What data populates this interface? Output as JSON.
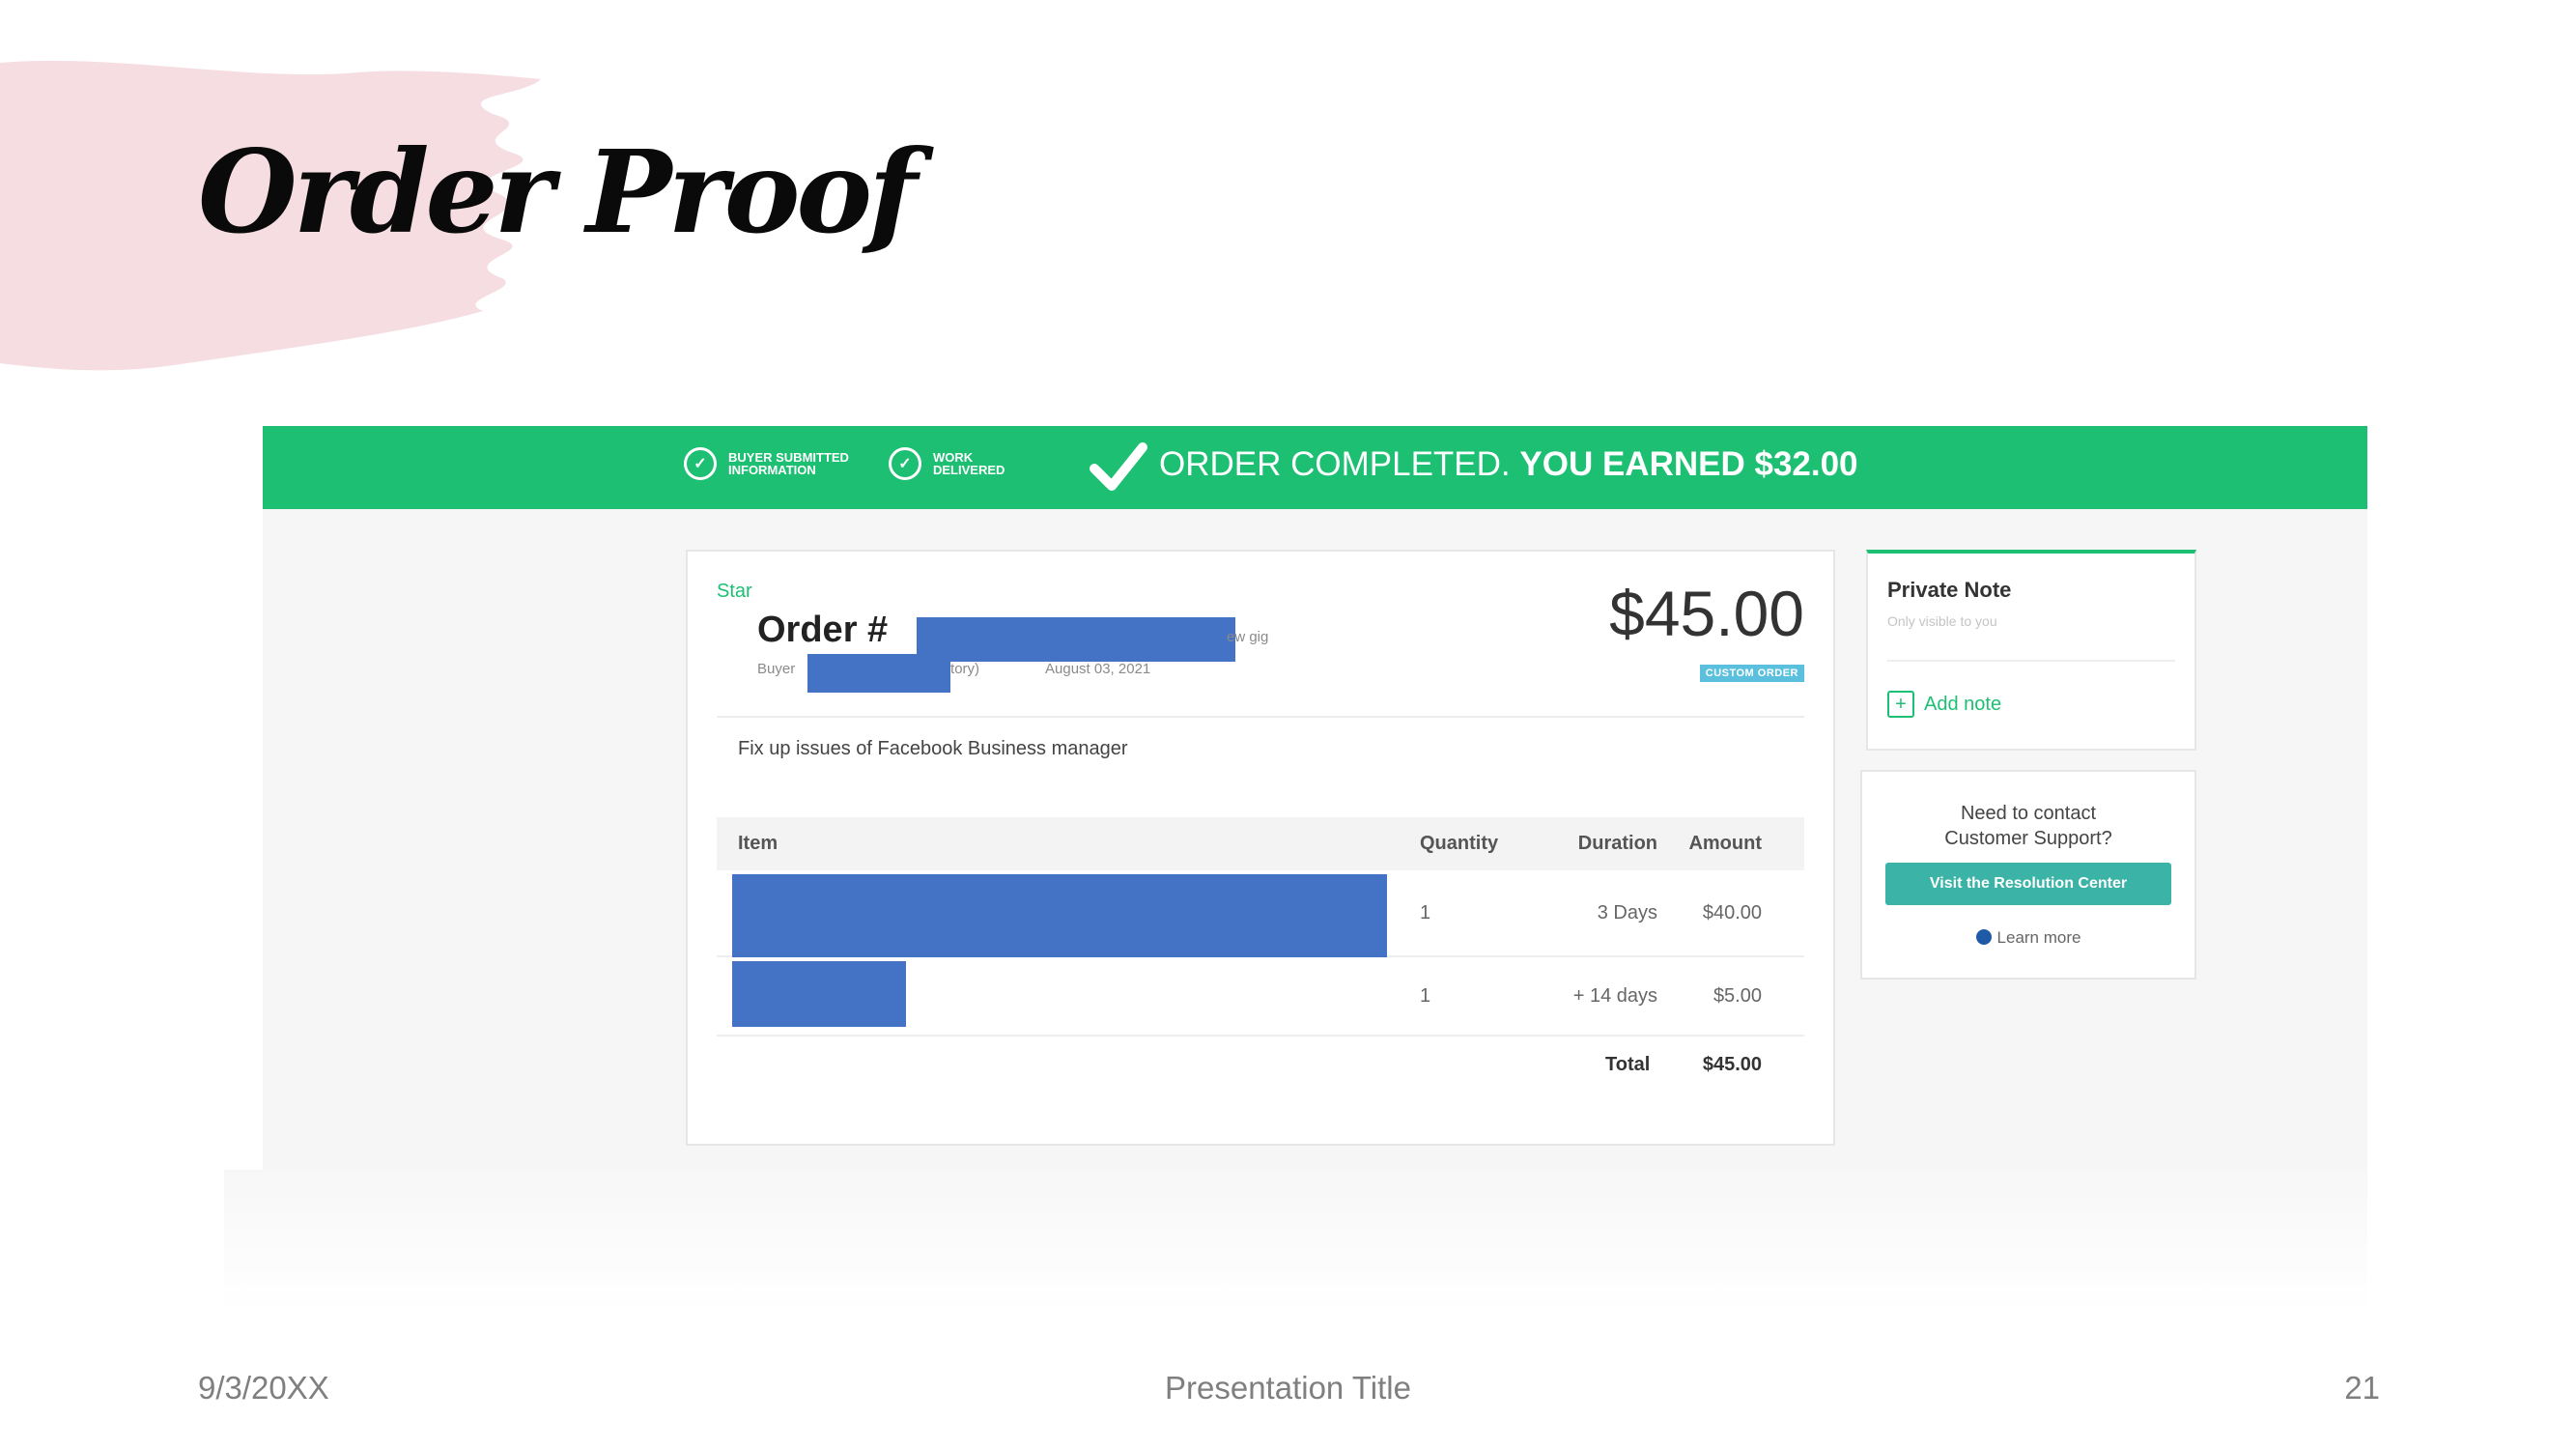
{
  "slide": {
    "title": "Order Proof",
    "footer_date": "9/3/20XX",
    "footer_title": "Presentation Title",
    "page_number": "21"
  },
  "colors": {
    "banner_green": "#1dbf73",
    "redaction_blue": "#4472c4",
    "brush_pink": "#f5dde2",
    "resolution_button": "#3bb3a6"
  },
  "banner": {
    "step1": "BUYER SUBMITTED INFORMATION",
    "step2": "WORK DELIVERED",
    "status": "ORDER COMPLETED.",
    "earned": "YOU EARNED $32.00"
  },
  "order": {
    "star_label": "Star",
    "title_prefix": "Order #",
    "view_gig_fragment": "ew gig",
    "buyer_prefix": "Buyer",
    "history_fragment": "v history)",
    "date": "August 03, 2021",
    "price": "$45.00",
    "badge": "CUSTOM ORDER",
    "description": "Fix up issues of Facebook Business manager",
    "table": {
      "headers": {
        "item": "Item",
        "quantity": "Quantity",
        "duration": "Duration",
        "amount": "Amount"
      },
      "rows": [
        {
          "quantity": "1",
          "duration": "3 Days",
          "amount": "$40.00"
        },
        {
          "quantity": "1",
          "duration": "+ 14 days",
          "amount": "$5.00"
        }
      ],
      "total_label": "Total",
      "total_value": "$45.00"
    }
  },
  "private_note": {
    "title": "Private Note",
    "subtitle": "Only visible to you",
    "add_label": "Add note"
  },
  "support": {
    "line1": "Need to contact",
    "line2": "Customer Support?",
    "button": "Visit the Resolution Center",
    "learn_more": "Learn more"
  }
}
